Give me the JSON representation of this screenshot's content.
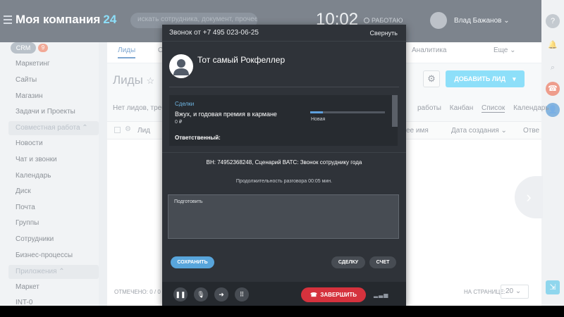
{
  "header": {
    "company_name": "Моя компания",
    "company_suffix": "24",
    "search_placeholder": "искать сотрудника, документ, прочее...",
    "clock": "10:02",
    "work_status": "РАБОТАЮ",
    "user_name": "Влад Бажанов",
    "user_chevron": "⌄"
  },
  "sidebar": {
    "crm_label": "CRM",
    "crm_count": "9",
    "items": [
      "Маркетинг",
      "Сайты",
      "Магазин",
      "Задачи и Проекты"
    ],
    "group_collab": "Совместная работа ⌃",
    "collab_items": [
      "Новости",
      "Чат и звонки",
      "Календарь",
      "Диск",
      "Почта",
      "Группы",
      "Сотрудники",
      "Бизнес-процессы"
    ],
    "group_apps": "Приложения ⌃",
    "app_items": [
      "Маркет",
      "INT-0"
    ]
  },
  "main": {
    "tabs": [
      "Лиды",
      "С",
      "Аналитика",
      "Еще ⌄"
    ],
    "title": "Лиды",
    "star": "☆",
    "filter_text": "Нет лидов, требу",
    "work_label": "работы",
    "view_links": [
      "Канбан",
      "Список",
      "Календарь"
    ],
    "add_lead": "ДОБАВИТЬ ЛИД",
    "add_lead_arrow": "▾",
    "columns": [
      "Лид",
      "ее имя",
      "Дата создания ⌄",
      "Отве"
    ],
    "selected_count": "ОТМЕЧЕНО: 0 / 0",
    "per_page_label": "НА СТРАНИЦЕ:",
    "per_page_value": "20 ⌄"
  },
  "call": {
    "title": "Звонок от +7 495 023-06-25",
    "collapse": "Свернуть",
    "caller_name": "Тот самый Рокфеллер",
    "deals_label": "Сделки",
    "deal_name": "Вжух, и годовая премия в кармане",
    "deal_amount": "0 ₽",
    "deal_stage": "Новая",
    "deal_progress": 0.17,
    "responsible_label": "Ответственный:",
    "call_info": "ВН: 74952368248, Сценарий ВАТС: Звонок сотруднику года",
    "duration": "Продолжительность разговора 00:05 мин.",
    "comment": "Подготовить",
    "save": "СОХРАНИТЬ",
    "deal_btn": "СДЕЛКУ",
    "invoice_btn": "СЧЕТ",
    "hangup": "ЗАВЕРШИТЬ",
    "hangup_icon": "☎"
  },
  "icons": {
    "pause": "❚❚",
    "mic": "🎙",
    "transfer": "➜",
    "dialpad": "⠿",
    "gear": "⚙",
    "scroll_right": "›",
    "help": "?",
    "bell": "🔔",
    "search": "⌕",
    "phone": "☎",
    "user": "👤",
    "signal": "▂▃▅"
  },
  "colors": {
    "header_bg": "#1f2c3c",
    "accent": "#3bc8f5",
    "hangup": "#d5323d",
    "save": "#58a5db"
  }
}
